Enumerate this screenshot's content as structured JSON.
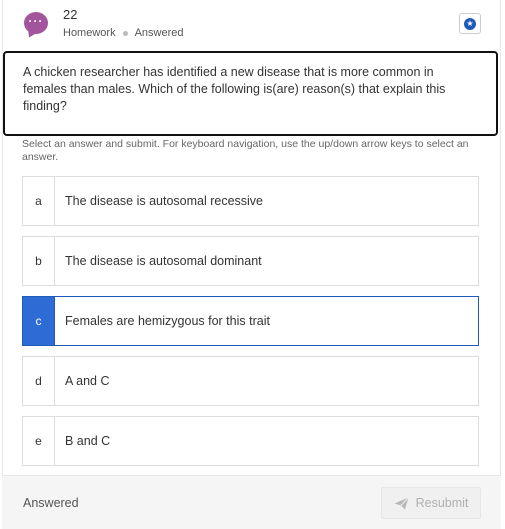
{
  "question": {
    "number": "22",
    "type": "Homework",
    "status": "Answered",
    "prompt": "A chicken researcher has identified a new disease that is more common in females than males. Which of the following is(are) reason(s) that explain this finding?"
  },
  "instructions": "Select an answer and submit. For keyboard navigation, use the up/down arrow keys to select an answer.",
  "options": [
    {
      "letter": "a",
      "text": "The disease is autosomal recessive"
    },
    {
      "letter": "b",
      "text": "The disease is autosomal dominant"
    },
    {
      "letter": "c",
      "text": "Females are hemizygous for this trait"
    },
    {
      "letter": "d",
      "text": "A and C"
    },
    {
      "letter": "e",
      "text": "B and C"
    }
  ],
  "selected_option": "c",
  "footer": {
    "status": "Answered",
    "resubmit_label": "Resubmit"
  },
  "icons": {
    "question_badge": "chat-bubble-icon",
    "bookmark": "bookmark-star-icon",
    "resubmit": "send-icon"
  },
  "colors": {
    "badge": "#a2559d",
    "accent": "#2d6cd4"
  }
}
